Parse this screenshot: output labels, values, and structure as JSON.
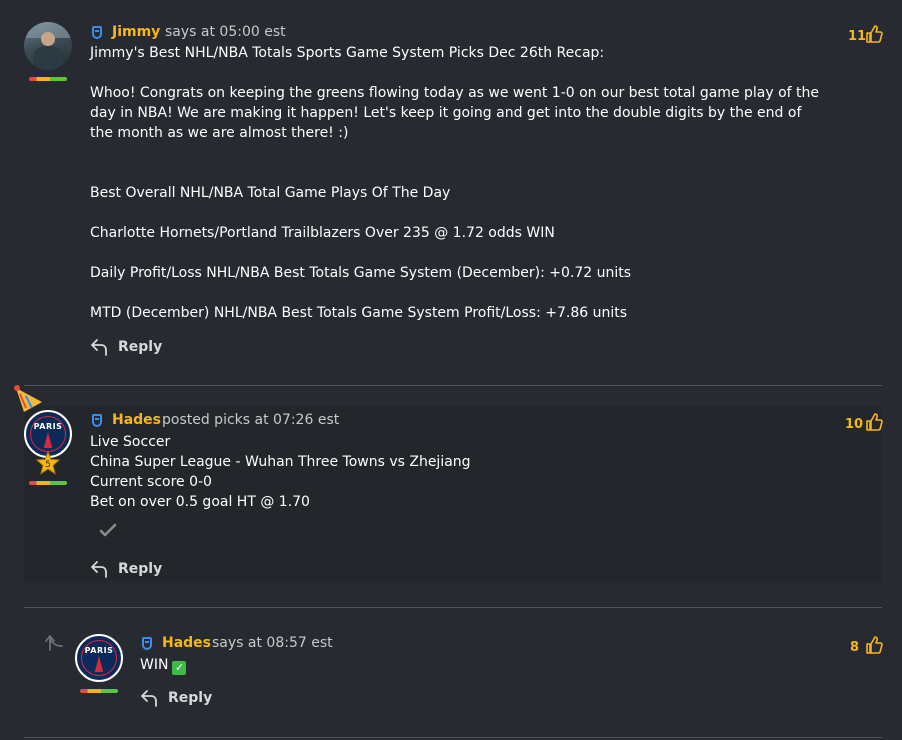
{
  "comments": [
    {
      "author": "Jimmy",
      "meta": "says at 05:00 est",
      "likes": "11",
      "lines": [
        "Jimmy's Best NHL/NBA Totals Sports Game System Picks Dec 26th Recap:",
        "",
        "Whoo! Congrats on keeping the greens flowing today as we went 1-0 on our best total game play of the",
        "day in NBA! We are making it happen! Let's keep it going and get into the double digits by the end of",
        "the month as we are almost there! :)",
        "",
        "",
        "Best Overall NHL/NBA Total Game Plays Of The Day",
        "",
        "Charlotte Hornets/Portland Trailblazers Over 235 @ 1.72 odds WIN",
        "",
        "Daily Profit/Loss NHL/NBA Best Totals Game System (December): +0.72 units",
        "",
        "MTD (December) NHL/NBA Best Totals Game System Profit/Loss: +7.86 units"
      ],
      "reply_label": "Reply"
    },
    {
      "author": "Hades",
      "meta": "posted picks at 07:26 est",
      "likes": "10",
      "lines": [
        "Live Soccer",
        "China Super League - Wuhan Three Towns vs Zhejiang",
        "Current score 0-0",
        "Bet on over 0.5 goal HT @ 1.70"
      ],
      "badge_level": "5",
      "reply_label": "Reply"
    },
    {
      "author": "Hades",
      "meta": "says at 08:57 est",
      "likes": "8",
      "text": "WIN",
      "reply_label": "Reply"
    }
  ],
  "avatar_text": "PARIS",
  "icons": {
    "medal": "medal-icon",
    "thumbs_up": "thumbs-up-icon",
    "reply": "reply-arrow-icon",
    "check": "check-icon",
    "party_hat": "party-hat-icon",
    "star": "star-icon",
    "thread": "thread-reply-icon",
    "win_check": "green-check-icon"
  },
  "colors": {
    "background": "#272a30",
    "author": "#f7b718",
    "likes": "#f7b718",
    "medal": "#3a8fe8"
  }
}
